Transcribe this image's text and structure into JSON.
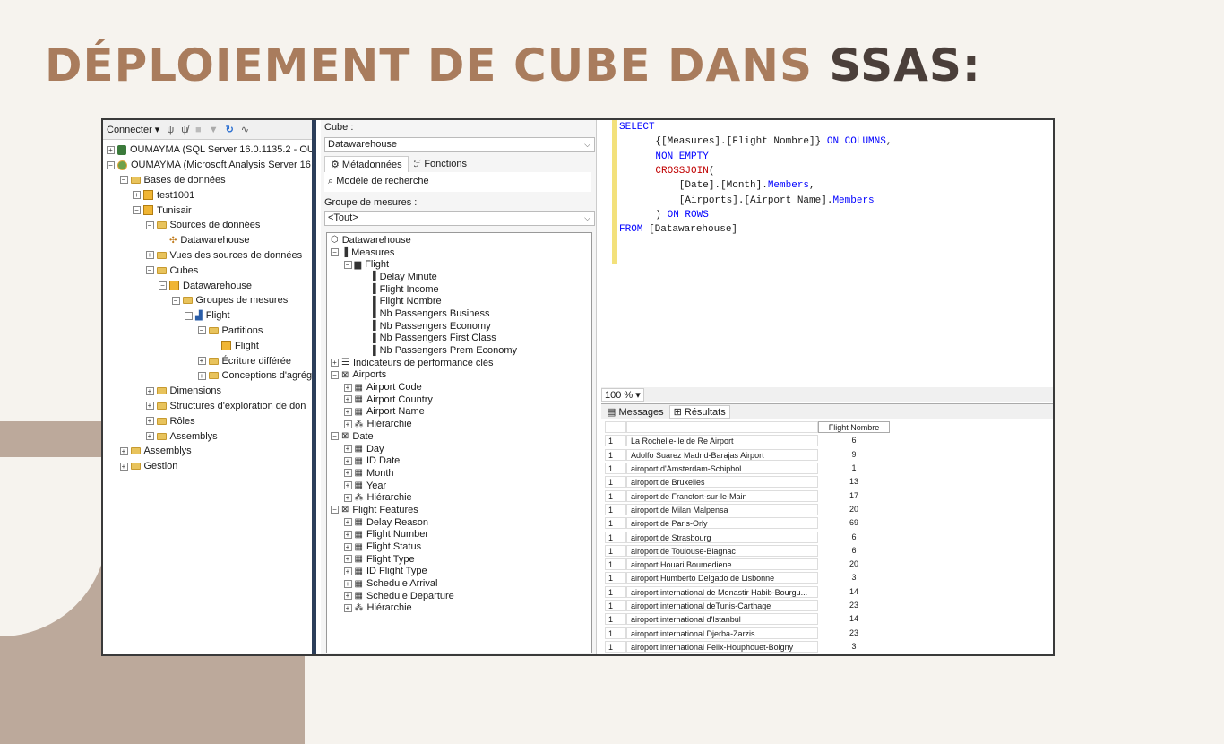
{
  "slide": {
    "title_part1": "DÉPLOIEMENT DE CUBE  DANS ",
    "title_part2": "SSAS:"
  },
  "object_explorer": {
    "connect_label": "Connecter ▾",
    "rows": [
      {
        "label": "OUMAYMA (SQL Server 16.0.1135.2 - OU",
        "indent": 0,
        "exp": "+",
        "icon": "db"
      },
      {
        "label": "OUMAYMA (Microsoft Analysis Server 16",
        "indent": 0,
        "exp": "-",
        "icon": "srv"
      },
      {
        "label": "Bases de données",
        "indent": 1,
        "exp": "-",
        "icon": "folder"
      },
      {
        "label": "test1001",
        "indent": 2,
        "exp": "+",
        "icon": "cube"
      },
      {
        "label": "Tunisair",
        "indent": 2,
        "exp": "-",
        "icon": "cube"
      },
      {
        "label": "Sources de données",
        "indent": 3,
        "exp": "-",
        "icon": "folder"
      },
      {
        "label": "Datawarehouse",
        "indent": 4,
        "exp": "",
        "icon": "datasource"
      },
      {
        "label": "Vues des sources de données",
        "indent": 3,
        "exp": "+",
        "icon": "folder"
      },
      {
        "label": "Cubes",
        "indent": 3,
        "exp": "-",
        "icon": "folder"
      },
      {
        "label": "Datawarehouse",
        "indent": 4,
        "exp": "-",
        "icon": "cube"
      },
      {
        "label": "Groupes de mesures",
        "indent": 5,
        "exp": "-",
        "icon": "folder"
      },
      {
        "label": "Flight",
        "indent": 6,
        "exp": "-",
        "icon": "chart"
      },
      {
        "label": "Partitions",
        "indent": 7,
        "exp": "-",
        "icon": "folder"
      },
      {
        "label": "Flight",
        "indent": 8,
        "exp": "",
        "icon": "cube"
      },
      {
        "label": "Écriture différée",
        "indent": 7,
        "exp": "+",
        "icon": "folder"
      },
      {
        "label": "Conceptions d'agrég",
        "indent": 7,
        "exp": "+",
        "icon": "folder"
      },
      {
        "label": "Dimensions",
        "indent": 3,
        "exp": "+",
        "icon": "folder"
      },
      {
        "label": "Structures d'exploration de don",
        "indent": 3,
        "exp": "+",
        "icon": "folder"
      },
      {
        "label": "Rôles",
        "indent": 3,
        "exp": "+",
        "icon": "folder"
      },
      {
        "label": "Assemblys",
        "indent": 3,
        "exp": "+",
        "icon": "folder"
      },
      {
        "label": "Assemblys",
        "indent": 1,
        "exp": "+",
        "icon": "folder"
      },
      {
        "label": "Gestion",
        "indent": 1,
        "exp": "+",
        "icon": "folder"
      }
    ]
  },
  "cube_browser": {
    "cube_label": "Cube :",
    "cube_value": "Datawarehouse",
    "tab_metadata": "Métadonnées",
    "tab_functions": "Fonctions",
    "search_label": "Modèle de recherche",
    "measure_group_label": "Groupe de mesures :",
    "measure_group_value": "<Tout>",
    "tree": [
      {
        "label": "Datawarehouse",
        "indent": 0,
        "exp": "",
        "icon": "cube-icon"
      },
      {
        "label": "Measures",
        "indent": 0,
        "exp": "-",
        "icon": "measures-icon"
      },
      {
        "label": "Flight",
        "indent": 1,
        "exp": "-",
        "icon": "folder-icon"
      },
      {
        "label": "Delay Minute",
        "indent": 3,
        "exp": "",
        "icon": "measure-icon"
      },
      {
        "label": "Flight Income",
        "indent": 3,
        "exp": "",
        "icon": "measure-icon"
      },
      {
        "label": "Flight Nombre",
        "indent": 3,
        "exp": "",
        "icon": "measure-icon"
      },
      {
        "label": "Nb Passengers Business",
        "indent": 3,
        "exp": "",
        "icon": "measure-icon"
      },
      {
        "label": "Nb Passengers Economy",
        "indent": 3,
        "exp": "",
        "icon": "measure-icon"
      },
      {
        "label": "Nb Passengers First Class",
        "indent": 3,
        "exp": "",
        "icon": "measure-icon"
      },
      {
        "label": "Nb Passengers Prem Economy",
        "indent": 3,
        "exp": "",
        "icon": "measure-icon"
      },
      {
        "label": "Indicateurs de performance clés",
        "indent": 0,
        "exp": "+",
        "icon": "kpi-icon"
      },
      {
        "label": "Airports",
        "indent": 0,
        "exp": "-",
        "icon": "dimension-icon"
      },
      {
        "label": "Airport Code",
        "indent": 1,
        "exp": "+",
        "icon": "attribute-icon"
      },
      {
        "label": "Airport Country",
        "indent": 1,
        "exp": "+",
        "icon": "attribute-icon"
      },
      {
        "label": "Airport Name",
        "indent": 1,
        "exp": "+",
        "icon": "attribute-icon"
      },
      {
        "label": "Hiérarchie",
        "indent": 1,
        "exp": "+",
        "icon": "hierarchy-icon"
      },
      {
        "label": "Date",
        "indent": 0,
        "exp": "-",
        "icon": "dimension-icon"
      },
      {
        "label": "Day",
        "indent": 1,
        "exp": "+",
        "icon": "attribute-icon"
      },
      {
        "label": "ID Date",
        "indent": 1,
        "exp": "+",
        "icon": "attribute-icon"
      },
      {
        "label": "Month",
        "indent": 1,
        "exp": "+",
        "icon": "attribute-icon"
      },
      {
        "label": "Year",
        "indent": 1,
        "exp": "+",
        "icon": "attribute-icon"
      },
      {
        "label": "Hiérarchie",
        "indent": 1,
        "exp": "+",
        "icon": "hierarchy-icon"
      },
      {
        "label": "Flight Features",
        "indent": 0,
        "exp": "-",
        "icon": "dimension-icon"
      },
      {
        "label": "Delay Reason",
        "indent": 1,
        "exp": "+",
        "icon": "attribute-icon"
      },
      {
        "label": "Flight Number",
        "indent": 1,
        "exp": "+",
        "icon": "attribute-icon"
      },
      {
        "label": "Flight Status",
        "indent": 1,
        "exp": "+",
        "icon": "attribute-icon"
      },
      {
        "label": "Flight Type",
        "indent": 1,
        "exp": "+",
        "icon": "attribute-icon"
      },
      {
        "label": "ID Flight Type",
        "indent": 1,
        "exp": "+",
        "icon": "attribute-icon"
      },
      {
        "label": "Schedule Arrival",
        "indent": 1,
        "exp": "+",
        "icon": "attribute-icon"
      },
      {
        "label": "Schedule Departure",
        "indent": 1,
        "exp": "+",
        "icon": "attribute-icon"
      },
      {
        "label": "Hiérarchie",
        "indent": 1,
        "exp": "+",
        "icon": "hierarchy-icon"
      }
    ]
  },
  "query_editor": {
    "lines": [
      [
        {
          "t": "SELECT",
          "c": "kw"
        }
      ],
      [
        {
          "t": "    {[Measures].[Flight Nombre]} ",
          "c": "pl"
        },
        {
          "t": "ON COLUMNS",
          "c": "kw"
        },
        {
          "t": ",",
          "c": "pl"
        }
      ],
      [
        {
          "t": "    ",
          "c": "pl"
        },
        {
          "t": "NON EMPTY",
          "c": "kw"
        }
      ],
      [
        {
          "t": "    ",
          "c": "pl"
        },
        {
          "t": "CROSSJOIN",
          "c": "fn"
        },
        {
          "t": "(",
          "c": "pl"
        }
      ],
      [
        {
          "t": "        [Date].[Month].",
          "c": "pl"
        },
        {
          "t": "Members",
          "c": "kw"
        },
        {
          "t": ",",
          "c": "pl"
        }
      ],
      [
        {
          "t": "        [Airports].[Airport Name].",
          "c": "pl"
        },
        {
          "t": "Members",
          "c": "kw"
        }
      ],
      [
        {
          "t": "    ) ",
          "c": "pl"
        },
        {
          "t": "ON ROWS",
          "c": "kw"
        }
      ],
      [
        {
          "t": "FROM ",
          "c": "kw"
        },
        {
          "t": "[Datawarehouse]",
          "c": "pl"
        }
      ]
    ],
    "zoom": "100 %"
  },
  "results": {
    "tab_messages": "Messages",
    "tab_results": "Résultats",
    "column_header": "Flight Nombre",
    "rows": [
      {
        "month": "1",
        "airport": "La Rochelle-ile de Re Airport",
        "value": "6"
      },
      {
        "month": "1",
        "airport": "Adolfo Suarez Madrid-Barajas Airport",
        "value": "9"
      },
      {
        "month": "1",
        "airport": "airoport d'Amsterdam-Schiphol",
        "value": "1"
      },
      {
        "month": "1",
        "airport": "airoport de Bruxelles",
        "value": "13"
      },
      {
        "month": "1",
        "airport": "airoport de Francfort-sur-le-Main",
        "value": "17"
      },
      {
        "month": "1",
        "airport": "airoport de Milan Malpensa",
        "value": "20"
      },
      {
        "month": "1",
        "airport": "airoport de Paris-Orly",
        "value": "69"
      },
      {
        "month": "1",
        "airport": "airoport de Strasbourg",
        "value": "6"
      },
      {
        "month": "1",
        "airport": "airoport de Toulouse-Blagnac",
        "value": "6"
      },
      {
        "month": "1",
        "airport": "airoport Houari Boumediene",
        "value": "20"
      },
      {
        "month": "1",
        "airport": "airoport Humberto Delgado de Lisbonne",
        "value": "3"
      },
      {
        "month": "1",
        "airport": "airoport international de Monastir Habib-Bourgu...",
        "value": "14"
      },
      {
        "month": "1",
        "airport": "airoport international deTunis-Carthage",
        "value": "23"
      },
      {
        "month": "1",
        "airport": "airoport international d'Istanbul",
        "value": "14"
      },
      {
        "month": "1",
        "airport": "airoport international Djerba-Zarzis",
        "value": "23"
      },
      {
        "month": "1",
        "airport": "airoport international Felix-Houphouet-Boigny",
        "value": "3"
      }
    ]
  }
}
